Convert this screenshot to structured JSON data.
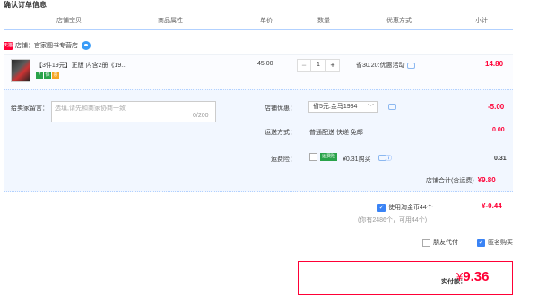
{
  "page_title": "确认订单信息",
  "headers": [
    "店铺宝贝",
    "商品属性",
    "单价",
    "数量",
    "优惠方式",
    "小计"
  ],
  "shop": {
    "badge": "天猫",
    "label": "店铺：",
    "name": "官家图书专营店"
  },
  "item": {
    "title": "【3件19元】正版 内含2册《19...",
    "badges": [
      "7",
      "保",
      "票"
    ],
    "price": "45.00",
    "qty_minus": "−",
    "qty": "1",
    "qty_plus": "+",
    "promo": "省30.20:优惠活动",
    "subtotal": "14.80"
  },
  "message": {
    "label": "给卖家留言：",
    "placeholder": "选填,请先和商家协商一致",
    "count": "0/200"
  },
  "coupon": {
    "label": "店铺优惠：",
    "selected": "省5元:金马1984",
    "value": "-5.00"
  },
  "shipping": {
    "label": "运送方式：",
    "text": "普通配送 快递 免邮",
    "value": "0.00"
  },
  "insurance": {
    "label": "运费险：",
    "tag": "运费险",
    "text": "¥0.31购买",
    "value": "0.31"
  },
  "shop_total": {
    "label": "店铺合计(含运费)",
    "value": "¥9.80"
  },
  "coins": {
    "label": "使用淘金币44个",
    "sub": "(你有2486个，可用44个)",
    "value": "¥-0.44"
  },
  "options": {
    "friend_pay": "朋友代付",
    "anonymous": "匿名购买"
  },
  "pay": {
    "label": "实付款：",
    "currency": "¥",
    "amount": "9.36"
  },
  "colors": {
    "accent_red": "#ff0036",
    "blue": "#3a83f5",
    "detail_bg": "#f2f7ff"
  }
}
